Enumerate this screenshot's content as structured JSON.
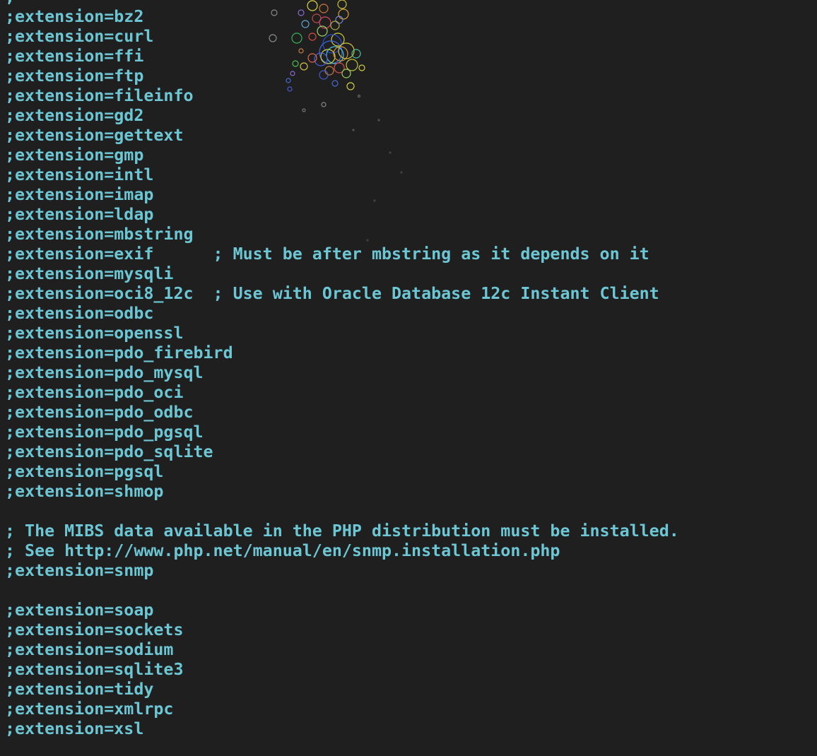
{
  "lines": [
    ";",
    ";extension=bz2",
    ";extension=curl",
    ";extension=ffi",
    ";extension=ftp",
    ";extension=fileinfo",
    ";extension=gd2",
    ";extension=gettext",
    ";extension=gmp",
    ";extension=intl",
    ";extension=imap",
    ";extension=ldap",
    ";extension=mbstring",
    ";extension=exif      ; Must be after mbstring as it depends on it",
    ";extension=mysqli",
    ";extension=oci8_12c  ; Use with Oracle Database 12c Instant Client",
    ";extension=odbc",
    ";extension=openssl",
    ";extension=pdo_firebird",
    ";extension=pdo_mysql",
    ";extension=pdo_oci",
    ";extension=pdo_odbc",
    ";extension=pdo_pgsql",
    ";extension=pdo_sqlite",
    ";extension=pgsql",
    ";extension=shmop",
    "",
    "; The MIBS data available in the PHP distribution must be installed.",
    "; See http://www.php.net/manual/en/snmp.installation.php",
    ";extension=snmp",
    "",
    ";extension=soap",
    ";extension=sockets",
    ";extension=sodium",
    ";extension=sqlite3",
    ";extension=tidy",
    ";extension=xmlrpc",
    ";extension=xsl"
  ],
  "colors": {
    "background": "#1f1f1f",
    "text": "#6cc6d4"
  }
}
